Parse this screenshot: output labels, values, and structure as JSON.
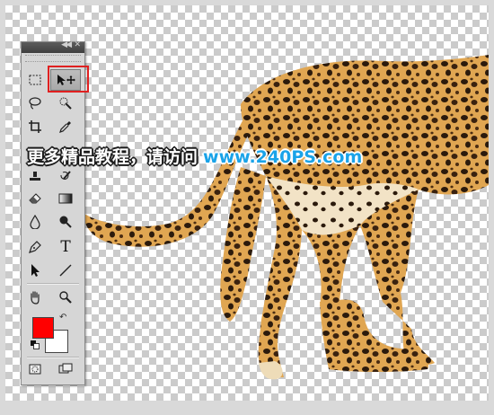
{
  "watermark": {
    "text_cn": "更多精品教程，请访问",
    "url": "www.240PS.com",
    "url_color": "#1aa3e8"
  },
  "image": {
    "subject": "leopard",
    "background": "transparent-checkerboard"
  },
  "tools_panel": {
    "header_icons": [
      "collapse-icon",
      "close-icon"
    ],
    "tools": [
      {
        "name": "rectangular-marquee-icon",
        "selected": false
      },
      {
        "name": "move-tool-icon",
        "selected": true
      },
      {
        "name": "lasso-icon",
        "selected": false
      },
      {
        "name": "quick-selection-icon",
        "selected": false
      },
      {
        "name": "crop-icon",
        "selected": false
      },
      {
        "name": "eyedropper-icon",
        "selected": false
      },
      {
        "name": "healing-brush-icon",
        "selected": false
      },
      {
        "name": "brush-icon",
        "selected": false
      },
      {
        "name": "clone-stamp-icon",
        "selected": false
      },
      {
        "name": "history-brush-icon",
        "selected": false
      },
      {
        "name": "eraser-icon",
        "selected": false
      },
      {
        "name": "gradient-icon",
        "selected": false
      },
      {
        "name": "blur-icon",
        "selected": false
      },
      {
        "name": "dodge-icon",
        "selected": false
      },
      {
        "name": "pen-icon",
        "selected": false
      },
      {
        "name": "type-icon",
        "selected": false
      },
      {
        "name": "path-selection-icon",
        "selected": false
      },
      {
        "name": "line-icon",
        "selected": false
      },
      {
        "name": "hand-icon",
        "selected": false
      },
      {
        "name": "zoom-icon",
        "selected": false
      },
      {
        "name": "quick-mask-icon",
        "selected": false
      },
      {
        "name": "screen-mode-icon",
        "selected": false
      }
    ],
    "type_tool_glyph": "T",
    "foreground_color": "#ff0000",
    "background_color": "#ffffff",
    "highlight_color": "#e02020"
  }
}
